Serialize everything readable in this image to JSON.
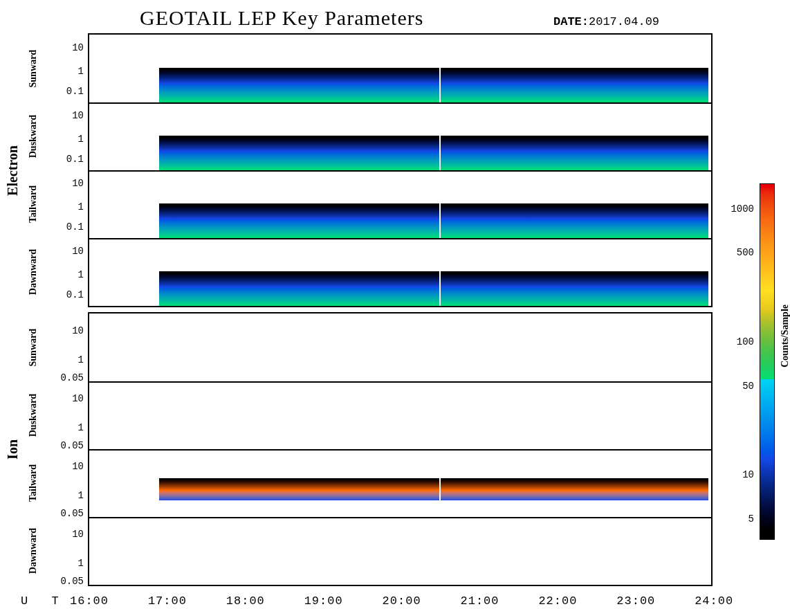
{
  "title": "GEOTAIL LEP Key Parameters",
  "date": {
    "label": "DATE:",
    "value": "2017.04.09"
  },
  "groups": [
    {
      "name": "Electron",
      "kind": "electron",
      "panels": [
        {
          "label": "Sunward",
          "kind": "spectrogram",
          "yticks": [
            "10",
            "1",
            "0.1"
          ]
        },
        {
          "label": "Duskward",
          "kind": "spectrogram",
          "yticks": [
            "10",
            "1",
            "0.1"
          ]
        },
        {
          "label": "Tailward",
          "kind": "spectrogram",
          "yticks": [
            "10",
            "1",
            "0.1"
          ]
        },
        {
          "label": "Dawnward",
          "kind": "spectrogram",
          "yticks": [
            "10",
            "1",
            "0.1"
          ]
        }
      ]
    },
    {
      "name": "Ion",
      "kind": "ion",
      "panels": [
        {
          "label": "Sunward",
          "kind": "empty",
          "yticks": [
            "10",
            "1",
            "0.05"
          ]
        },
        {
          "label": "Duskward",
          "kind": "empty",
          "yticks": [
            "10",
            "1",
            "0.05"
          ]
        },
        {
          "label": "Tailward",
          "kind": "spectrogram",
          "yticks": [
            "10",
            "1",
            "0.05"
          ]
        },
        {
          "label": "Dawnward",
          "kind": "empty",
          "yticks": [
            "10",
            "1",
            "0.05"
          ]
        }
      ]
    }
  ],
  "x_axis": {
    "label": "U T",
    "ticks": [
      "16:00",
      "17:00",
      "18:00",
      "19:00",
      "20:00",
      "21:00",
      "22:00",
      "23:00",
      "24:00"
    ]
  },
  "colorbar": {
    "label": "Counts/Sample",
    "ticks": [
      "1000",
      "500",
      "100",
      "50",
      "10",
      "5"
    ]
  }
}
